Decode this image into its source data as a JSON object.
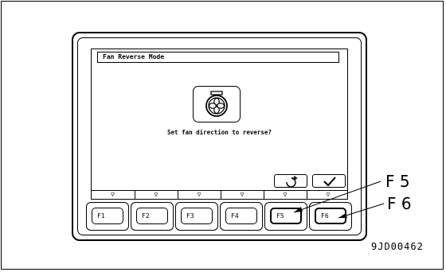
{
  "screen": {
    "title": "Fan Reverse Mode",
    "prompt": "Set fan direction to reverse?",
    "icon": "fan-icon",
    "buttons": [
      {
        "icon": "return-icon"
      },
      {
        "icon": "check-icon"
      }
    ]
  },
  "indicator_strip": [
    "▽",
    "▽",
    "▽",
    "▽",
    "▽",
    "▽"
  ],
  "function_keys": [
    "F1",
    "F2",
    "F3",
    "F4",
    "F5",
    "F6"
  ],
  "callouts": {
    "f5": "F 5",
    "f6": "F 6"
  },
  "figure_id": "9JD00462"
}
